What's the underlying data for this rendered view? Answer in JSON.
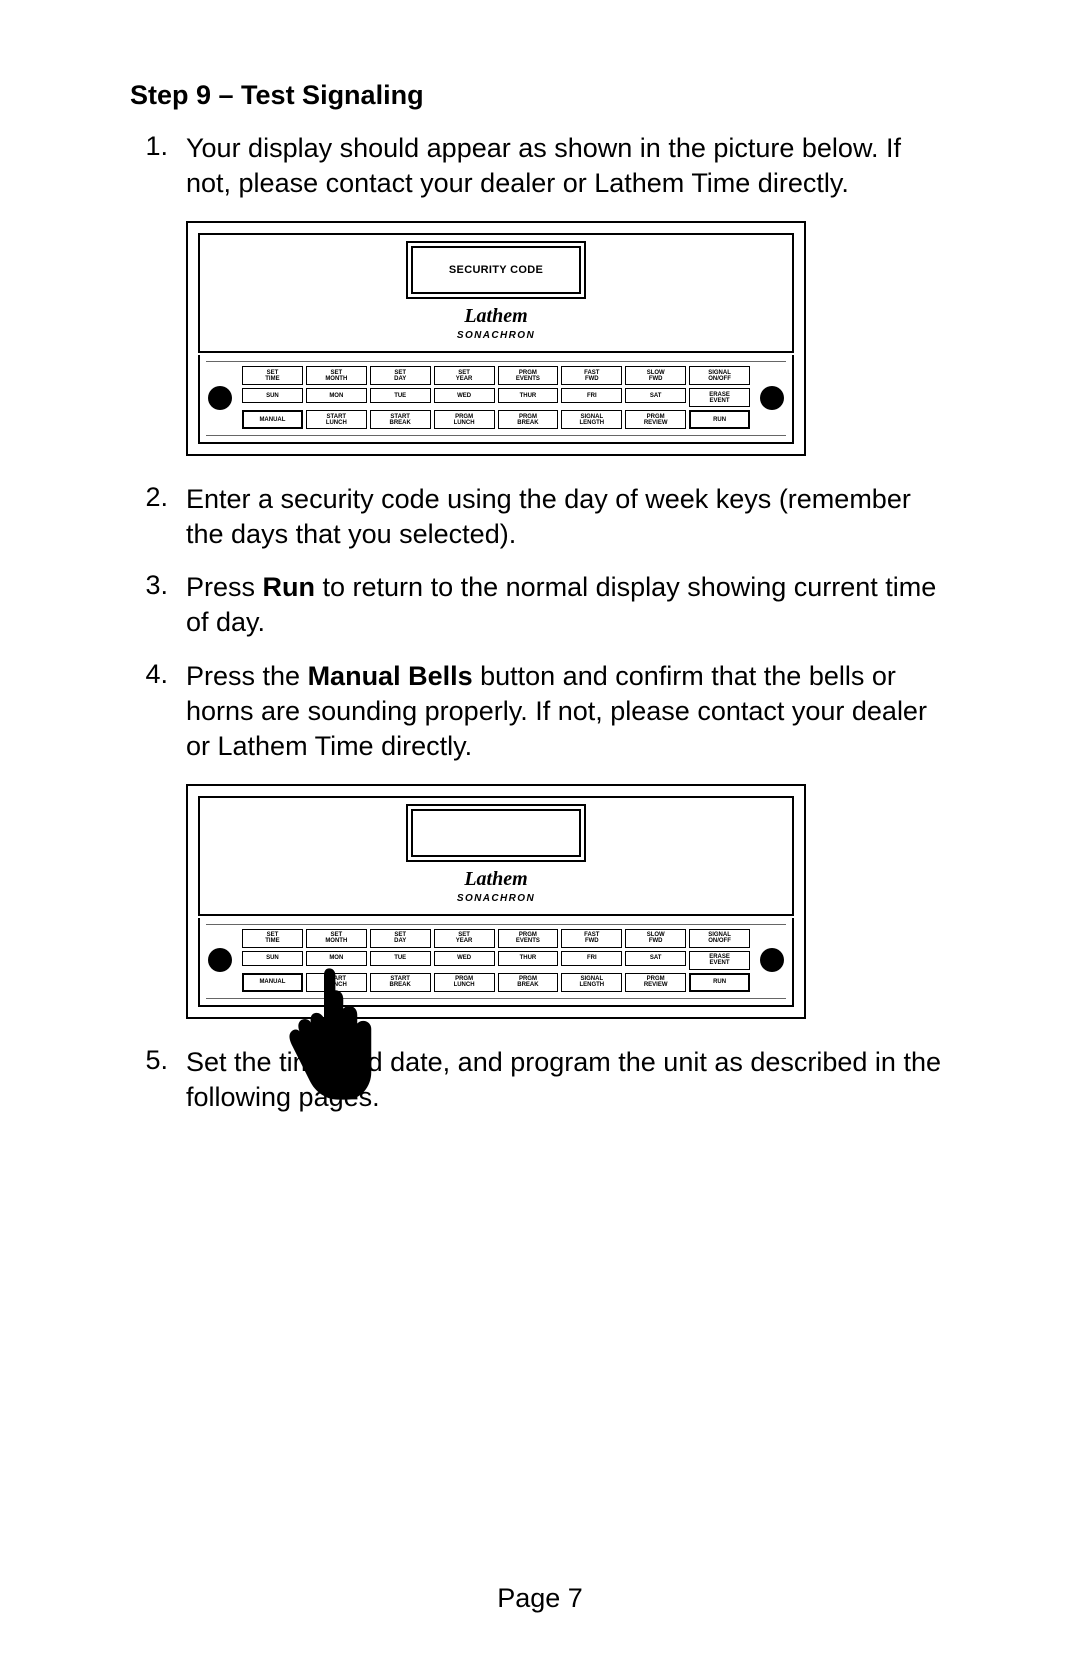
{
  "heading": "Step 9 – Test Signaling",
  "items": [
    {
      "num": "1.",
      "text_a": "Your display should appear as shown in the picture below.  If not, please contact your dealer or Lathem Time directly."
    },
    {
      "num": "2.",
      "text_a": "Enter a security code using the day of week keys (remember the days that you selected)."
    },
    {
      "num": "3.",
      "text_a": "Press ",
      "bold1": "Run",
      "text_b": " to return to the normal display showing current time of day."
    },
    {
      "num": "4.",
      "text_a": "Press the ",
      "bold1": "Manual Bells",
      "text_b": " button and confirm that the bells or horns are sounding properly.    If not, please contact your dealer or Lathem Time directly."
    },
    {
      "num": "5.",
      "text_a": "Set the time and date, and program the unit as described in the following pages."
    }
  ],
  "device": {
    "lcd1_text": "SECURITY CODE",
    "lcd2_text": "",
    "logo_script": "Lathem",
    "brand_sub": "SONACHRON",
    "keys_row1": [
      "SET\nTIME",
      "SET\nMONTH",
      "SET\nDAY",
      "SET\nYEAR",
      "PRGM\nEVENTS",
      "FAST\nFWD",
      "SLOW\nFWD",
      "SIGNAL\nON/OFF"
    ],
    "keys_row2": [
      "SUN",
      "MON",
      "TUE",
      "WED",
      "THUR",
      "FRI",
      "SAT",
      "ERASE\nEVENT"
    ],
    "keys_row3": [
      "MANUAL",
      "START\nLUNCH",
      "START\nBREAK",
      "PRGM\nLUNCH",
      "PRGM\nBREAK",
      "SIGNAL\nLENGTH",
      "PRGM\nREVIEW",
      "RUN"
    ]
  },
  "page_label": "Page 7"
}
